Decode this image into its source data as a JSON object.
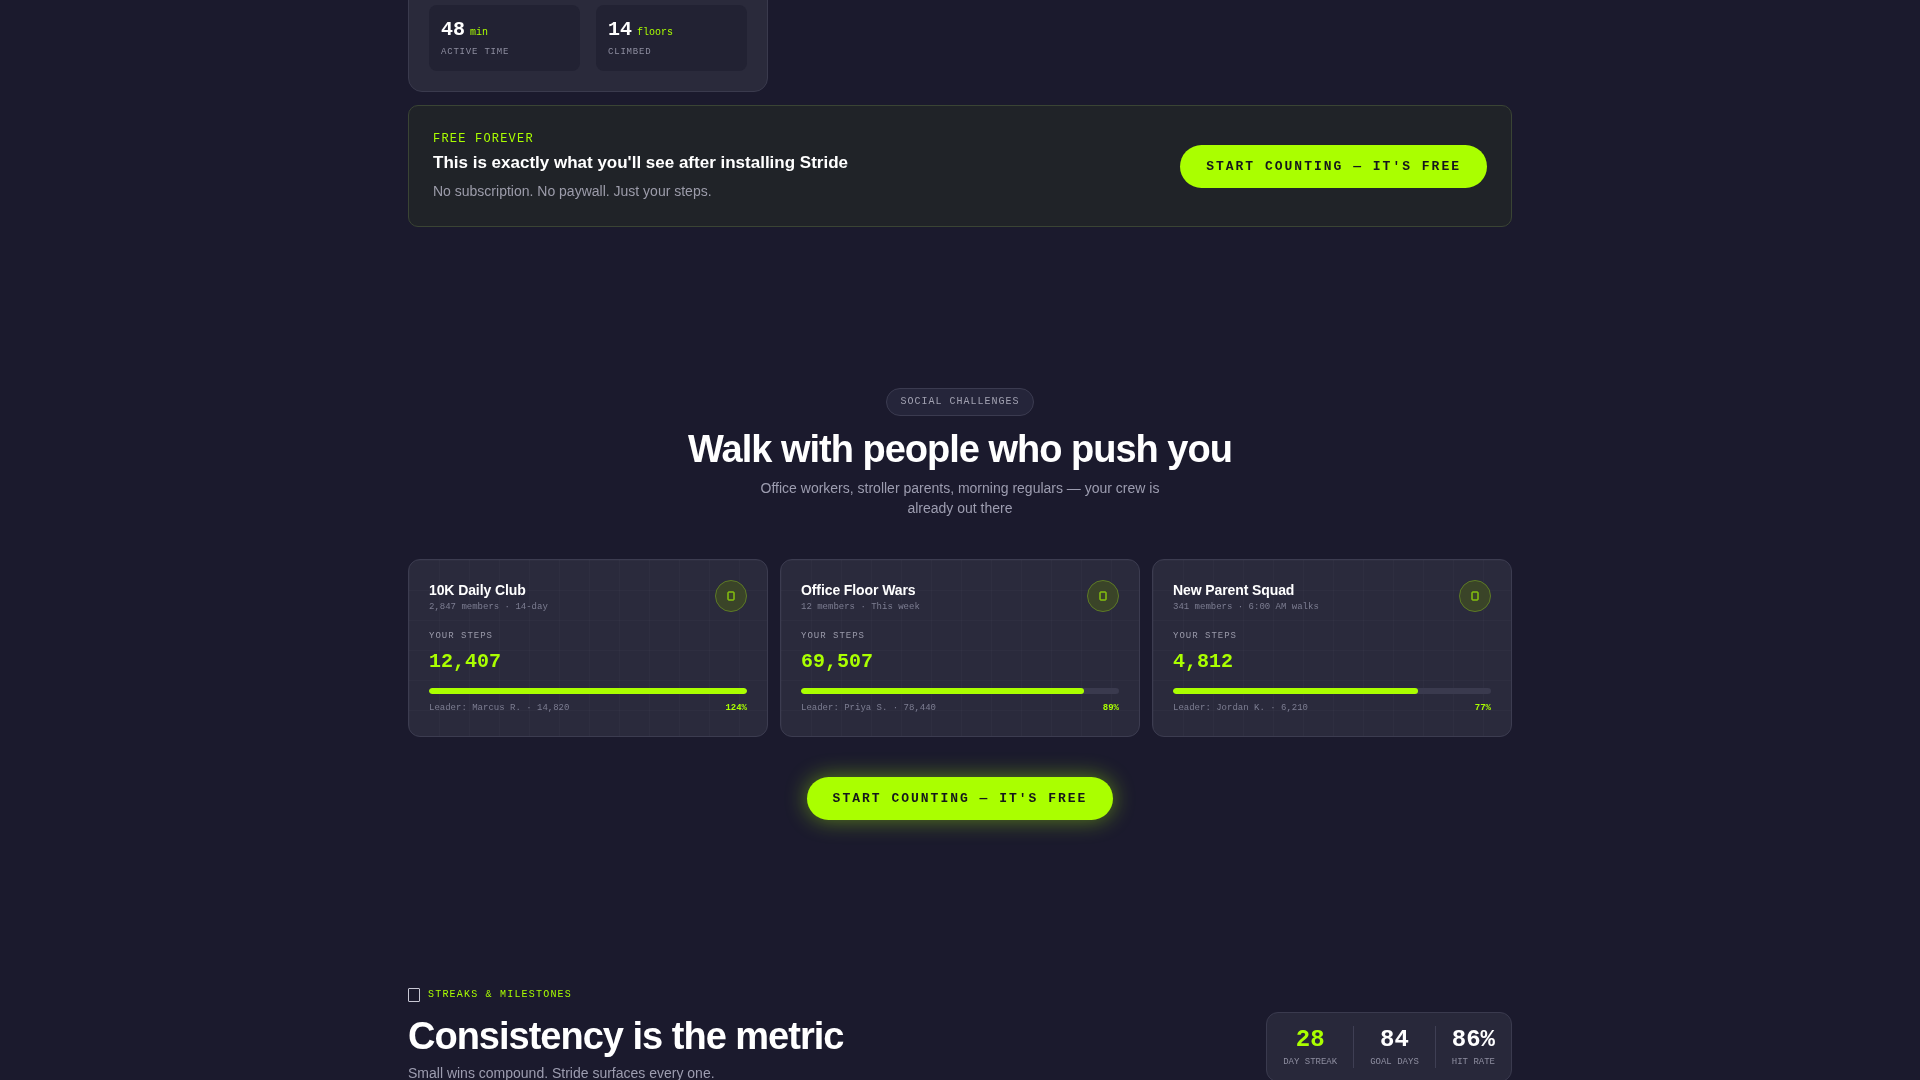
{
  "activity_panel": {
    "stats": [
      {
        "value": "48",
        "unit": "min",
        "label": "ACTIVE TIME"
      },
      {
        "value": "14",
        "unit": "floors",
        "label": "CLIMBED"
      }
    ]
  },
  "free_banner": {
    "eyebrow": "FREE FOREVER",
    "title": "This is exactly what you'll see after installing Stride",
    "subtitle": "No subscription. No paywall. Just your steps.",
    "button": "START COUNTING — IT'S FREE"
  },
  "challenges_section": {
    "tag": "SOCIAL CHALLENGES",
    "title": "Walk with people who push you",
    "subtitle": "Office workers, stroller parents, morning regulars — your crew is already out there",
    "cards": [
      {
        "name": "10K Daily Club",
        "meta": "2,847 members · 14-day",
        "steps_label": "YOUR STEPS",
        "steps": "12,407",
        "level": 1,
        "leader": "Leader: Marcus R. · 14,820",
        "percent": "124%"
      },
      {
        "name": "Office Floor Wars",
        "meta": "12 members · This week",
        "steps_label": "YOUR STEPS",
        "steps": "69,507",
        "level": 0.89,
        "leader": "Leader: Priya S. · 78,440",
        "percent": "89%"
      },
      {
        "name": "New Parent Squad",
        "meta": "341 members · 6:00 AM walks",
        "steps_label": "YOUR STEPS",
        "steps": "4,812",
        "level": 0.77,
        "leader": "Leader: Jordan K. · 6,210",
        "percent": "77%"
      }
    ],
    "button": "START COUNTING — IT'S FREE"
  },
  "streaks_section": {
    "eyebrow": "STREAKS & MILESTONES",
    "title": "Consistency is the metric",
    "subtitle": "Small wins compound. Stride surfaces every one.",
    "stats": [
      {
        "value": "28",
        "label": "DAY STREAK",
        "highlighted": true
      },
      {
        "value": "84",
        "label": "GOAL DAYS",
        "highlighted": false
      },
      {
        "value": "86%",
        "label": "HIT RATE",
        "highlighted": false
      }
    ]
  }
}
